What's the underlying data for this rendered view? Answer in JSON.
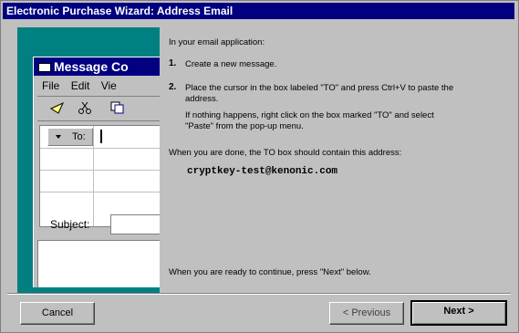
{
  "window": {
    "title": "Electronic Purchase Wizard: Address Email"
  },
  "illustration": {
    "app_title": "Message Co",
    "menu": [
      "File",
      "Edit",
      "Vie"
    ],
    "to_label": "To:",
    "subject_label": "Subject:"
  },
  "content": {
    "intro": "In your email application:",
    "step1_num": "1.",
    "step1_text": "Create a new message.",
    "step2_num": "2.",
    "step2_line1": "Place the cursor in the box labeled \"TO\" and press Ctrl+V to paste the",
    "step2_line2": "address.",
    "step2_note1": "If nothing happens, right click on the box marked \"TO\" and select",
    "step2_note2": "\"Paste\" from the pop-up menu.",
    "done_text": "When you are done, the TO box should contain this address:",
    "email": "cryptkey-test@kenonic.com",
    "continue_text": "When you are ready to continue, press \"Next\" below."
  },
  "buttons": {
    "cancel": "Cancel",
    "previous": "< Previous",
    "next": "Next >"
  }
}
